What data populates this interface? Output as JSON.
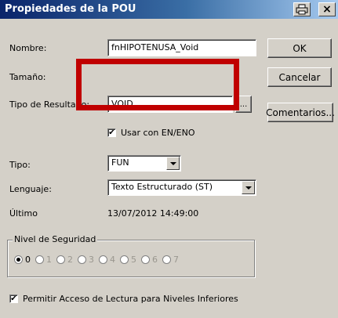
{
  "window": {
    "title": "Propiedades de la POU",
    "close_glyph": "×"
  },
  "fields": {
    "nombre_label": "Nombre:",
    "nombre_value": "fnHIPOTENUSA_Void",
    "tamano_label": "Tamaño:",
    "tipo_resultado_label": "Tipo de Resultado:",
    "tipo_resultado_value": "VOID",
    "tipo_resultado_browse": "...",
    "usar_en_eno_label": "Usar con EN/ENO",
    "usar_en_eno_checked": true,
    "tipo_label": "Tipo:",
    "tipo_value": "FUN",
    "lenguaje_label": "Lenguaje:",
    "lenguaje_value": "Texto Estructurado (ST)",
    "ultimo_label": "Último",
    "ultimo_value": "13/07/2012 14:49:00"
  },
  "buttons": {
    "ok": "OK",
    "cancelar": "Cancelar",
    "comentarios": "Comentarios..."
  },
  "security": {
    "group_label": "Nivel de Seguridad",
    "levels": [
      "0",
      "1",
      "2",
      "3",
      "4",
      "5",
      "6",
      "7"
    ],
    "selected": "0"
  },
  "footer": {
    "permitir_label": "Permitir Acceso de Lectura para Niveles Inferiores",
    "permitir_checked": true
  },
  "annotation": {
    "highlight_color": "#c00000"
  },
  "colors": {
    "title_start": "#0a246a",
    "title_end": "#a6caf0",
    "dialog_bg": "#d4d0c8"
  }
}
